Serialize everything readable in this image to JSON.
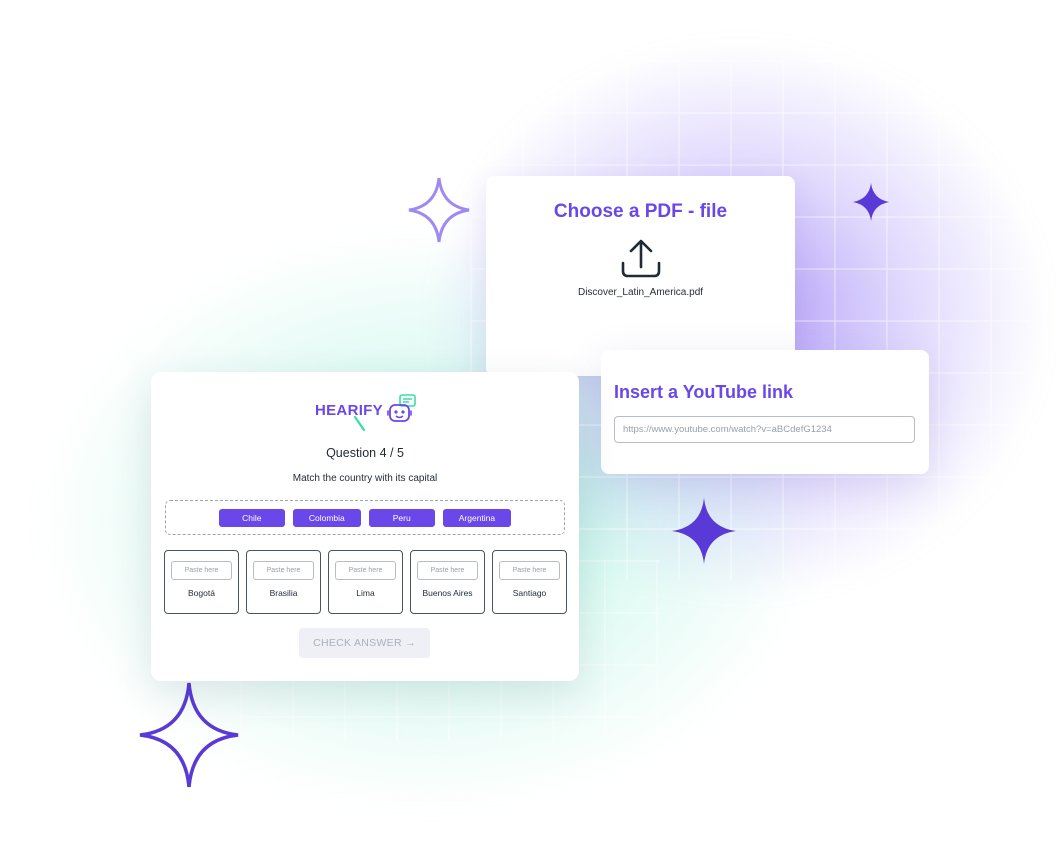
{
  "colors": {
    "accent": "#6a47e9",
    "accent_light": "#9f8af2",
    "accent_dark": "#5a3ad6",
    "logo_green": "#35e0a6",
    "text_dark": "#1f2a36",
    "disabled_text": "#a9b0be"
  },
  "pdf_card": {
    "title": "Choose a PDF - file",
    "icon": "upload-icon",
    "file_name": "Discover_Latin_America.pdf"
  },
  "youtube_card": {
    "title": "Insert a YouTube link",
    "input_placeholder": "https://www.youtube.com/watch?v=aBCdefG1234"
  },
  "quiz": {
    "logo_text": "HEARIFY",
    "question_label": "Question 4 / 5",
    "instruction": "Match the country with its capital",
    "countries": [
      "Chile",
      "Colombia",
      "Peru",
      "Argentina"
    ],
    "paste_placeholder": "Paste here",
    "capitals": [
      "Bogotá",
      "Brasilia",
      "Lima",
      "Buenos Aires",
      "Santiago"
    ],
    "check_button": "CHECK ANSWER →"
  }
}
